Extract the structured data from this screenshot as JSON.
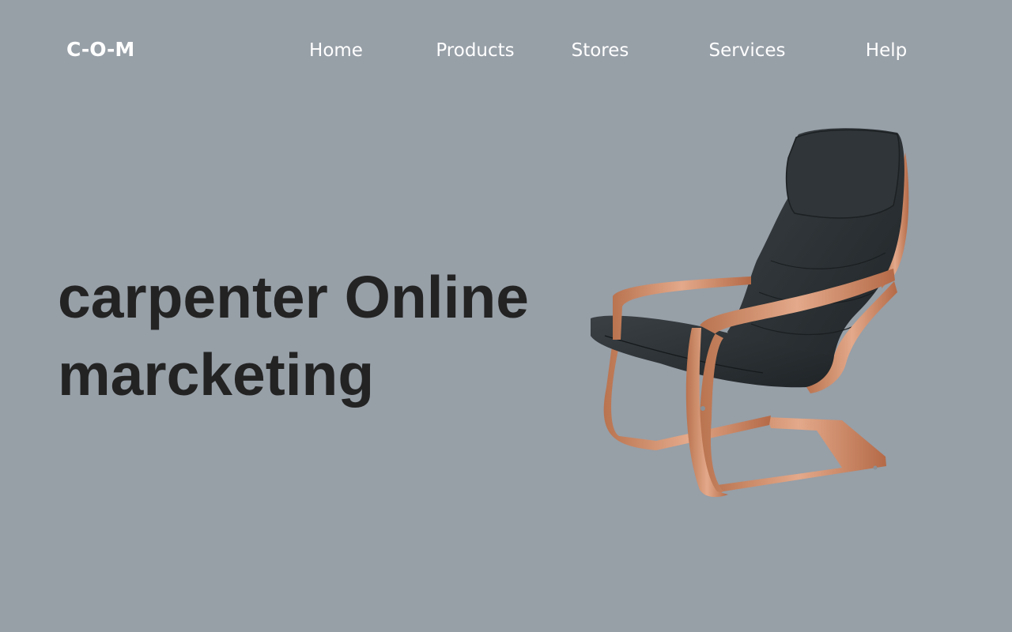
{
  "logo": "C-O-M",
  "nav": {
    "home": "Home",
    "products": "Products",
    "stores": "Stores",
    "services": "Services",
    "help": "Help"
  },
  "hero": {
    "line1": "carpenter Online",
    "line2": "marcketing"
  },
  "image": {
    "subject": "armchair-image"
  },
  "colors": {
    "background": "#979fa7",
    "text_light": "#ffffff",
    "heading": "#232323",
    "wood": "#c98a66",
    "cushion": "#2b3033"
  }
}
